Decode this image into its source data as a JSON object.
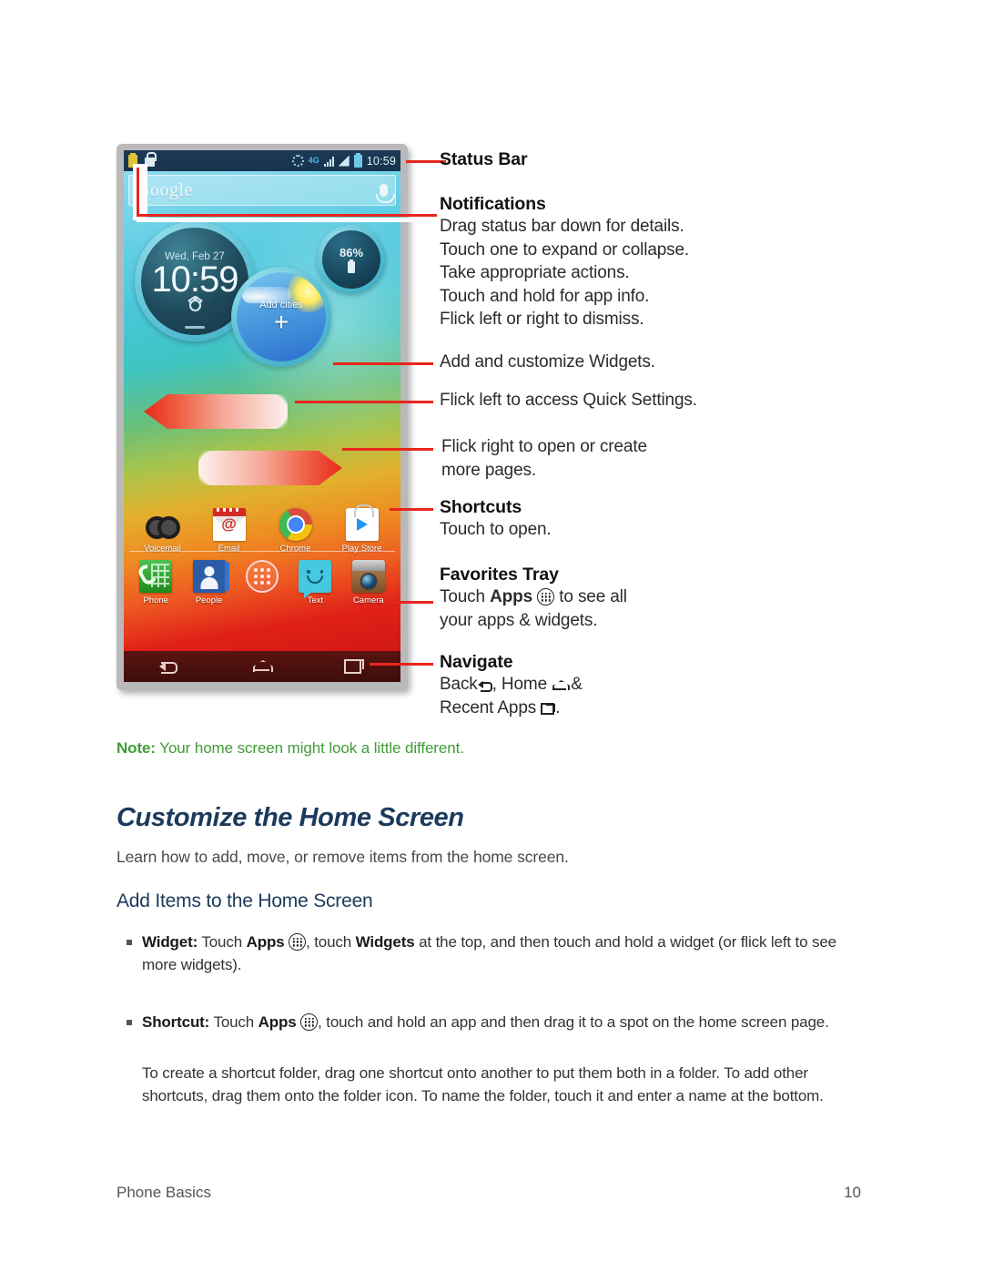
{
  "figure": {
    "phone": {
      "status_bar": {
        "icons_left": [
          "notification-icon",
          "lock-icon"
        ],
        "icons_right": [
          "sync-icon",
          "4g-icon",
          "signal-icon",
          "signal2-icon",
          "battery-icon"
        ],
        "network_label": "4G",
        "time": "10:59"
      },
      "search_widget": {
        "logo_text": "Google",
        "mic_icon": "microphone-icon"
      },
      "clock_widget": {
        "date": "Wed, Feb 27",
        "time": "10:59",
        "alarm_icon": "alarm-clock-icon"
      },
      "weather_widget": {
        "label": "Add cities",
        "plus": "+"
      },
      "battery_widget": {
        "percent": "86%",
        "icon": "battery-icon"
      },
      "shortcuts": [
        {
          "label": "Voicemail",
          "icon": "voicemail-icon"
        },
        {
          "label": "Email",
          "icon": "email-icon"
        },
        {
          "label": "Chrome",
          "icon": "chrome-icon"
        },
        {
          "label": "Play Store",
          "icon": "play-store-icon"
        }
      ],
      "favorites_tray": [
        {
          "label": "Phone",
          "icon": "phone-icon"
        },
        {
          "label": "People",
          "icon": "people-icon"
        },
        {
          "label": "",
          "icon": "apps-icon"
        },
        {
          "label": "Text",
          "icon": "text-message-icon"
        },
        {
          "label": "Camera",
          "icon": "camera-icon"
        }
      ],
      "nav_bar": [
        {
          "name": "back-button",
          "icon": "back-icon"
        },
        {
          "name": "home-button",
          "icon": "home-icon"
        },
        {
          "name": "recent-apps-button",
          "icon": "recent-apps-icon"
        }
      ]
    },
    "annotations": {
      "status_bar_heading": "Status Bar",
      "notifications_heading": "Notifications",
      "notifications_lines": [
        "Drag status bar down for details.",
        "Touch one to expand or collapse.",
        "Take appropriate actions.",
        "Touch and hold for app info.",
        "Flick left or right to dismiss."
      ],
      "widgets_line": "Add and customize Widgets.",
      "quick_settings_line": "Flick left to access Quick Settings.",
      "more_pages_line1": "Flick right to open or create",
      "more_pages_line2": "more pages.",
      "shortcuts_heading": "Shortcuts",
      "shortcuts_line": "Touch to open.",
      "favorites_heading": "Favorites Tray",
      "favorites_line1_pre": "Touch ",
      "favorites_line1_bold": "Apps",
      "favorites_line1_post": " to see all",
      "favorites_line2": "your apps & widgets.",
      "navigate_heading": "Navigate",
      "navigate_back": "Back",
      "navigate_home": "Home",
      "navigate_amp": "&",
      "navigate_recent": "Recent Apps"
    }
  },
  "note": {
    "label": "Note:",
    "text": " Your home screen might look a little different."
  },
  "headings": {
    "h1": "Customize the Home Screen",
    "intro": "Learn how to add, move, or remove items from the home screen.",
    "h2": "Add Items to the Home Screen"
  },
  "bullets": [
    {
      "term": "Widget:",
      "pre": " Touch ",
      "bold_apps": "Apps",
      "mid": ", touch ",
      "bold2": "Widgets",
      "post": " at the top, and then touch and hold a widget (or flick left to see more widgets)."
    },
    {
      "term": "Shortcut:",
      "pre": " Touch ",
      "bold_apps": "Apps",
      "mid": ", touch and hold an app and then drag it to a spot on the home screen page.",
      "bold2": "",
      "post": ""
    }
  ],
  "paragraph": "To create a shortcut folder, drag one shortcut onto another to put them both in a folder. To add other shortcuts, drag them onto the folder icon. To name the folder, touch it and enter a name at the bottom.",
  "footer": {
    "left": "Phone Basics",
    "right": "10"
  },
  "colors": {
    "accent_red": "#e8261c",
    "note_green": "#3f9c35",
    "heading_navy": "#1b3a5c",
    "body_gray": "#333333"
  }
}
